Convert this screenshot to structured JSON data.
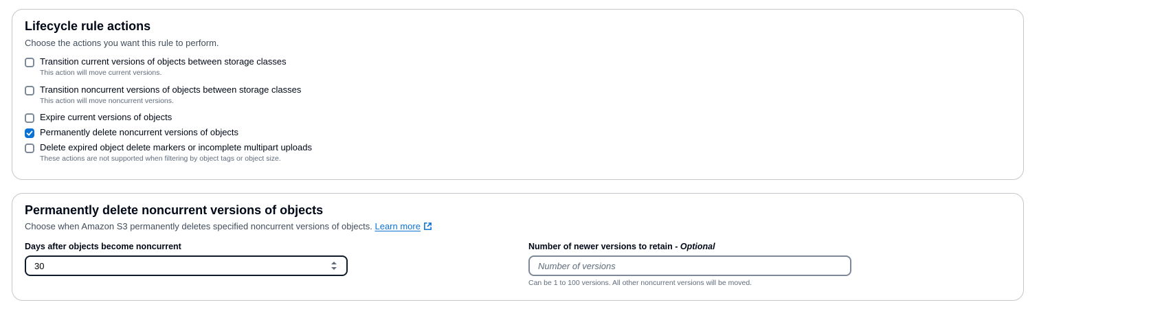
{
  "lifecycle_actions": {
    "title": "Lifecycle rule actions",
    "description": "Choose the actions you want this rule to perform.",
    "options": [
      {
        "label": "Transition current versions of objects between storage classes",
        "sub": "This action will move current versions.",
        "checked": false
      },
      {
        "label": "Transition noncurrent versions of objects between storage classes",
        "sub": "This action will move noncurrent versions.",
        "checked": false
      },
      {
        "label": "Expire current versions of objects",
        "sub": "",
        "checked": false
      },
      {
        "label": "Permanently delete noncurrent versions of objects",
        "sub": "",
        "checked": true
      },
      {
        "label": "Delete expired object delete markers or incomplete multipart uploads",
        "sub": "These actions are not supported when filtering by object tags or object size.",
        "checked": false
      }
    ]
  },
  "delete_noncurrent": {
    "title": "Permanently delete noncurrent versions of objects",
    "description": "Choose when Amazon S3 permanently deletes specified noncurrent versions of objects.",
    "learn_more": "Learn more",
    "days_field": {
      "label": "Days after objects become noncurrent",
      "value": "30"
    },
    "versions_field": {
      "label": "Number of newer versions to retain - ",
      "label_optional": "Optional",
      "placeholder": "Number of versions",
      "hint": "Can be 1 to 100 versions. All other noncurrent versions will be moved."
    }
  },
  "colors": {
    "accent": "#0972d3",
    "text": "#000716",
    "secondary_text": "#5f6b7a",
    "border": "#c6c6cd"
  }
}
